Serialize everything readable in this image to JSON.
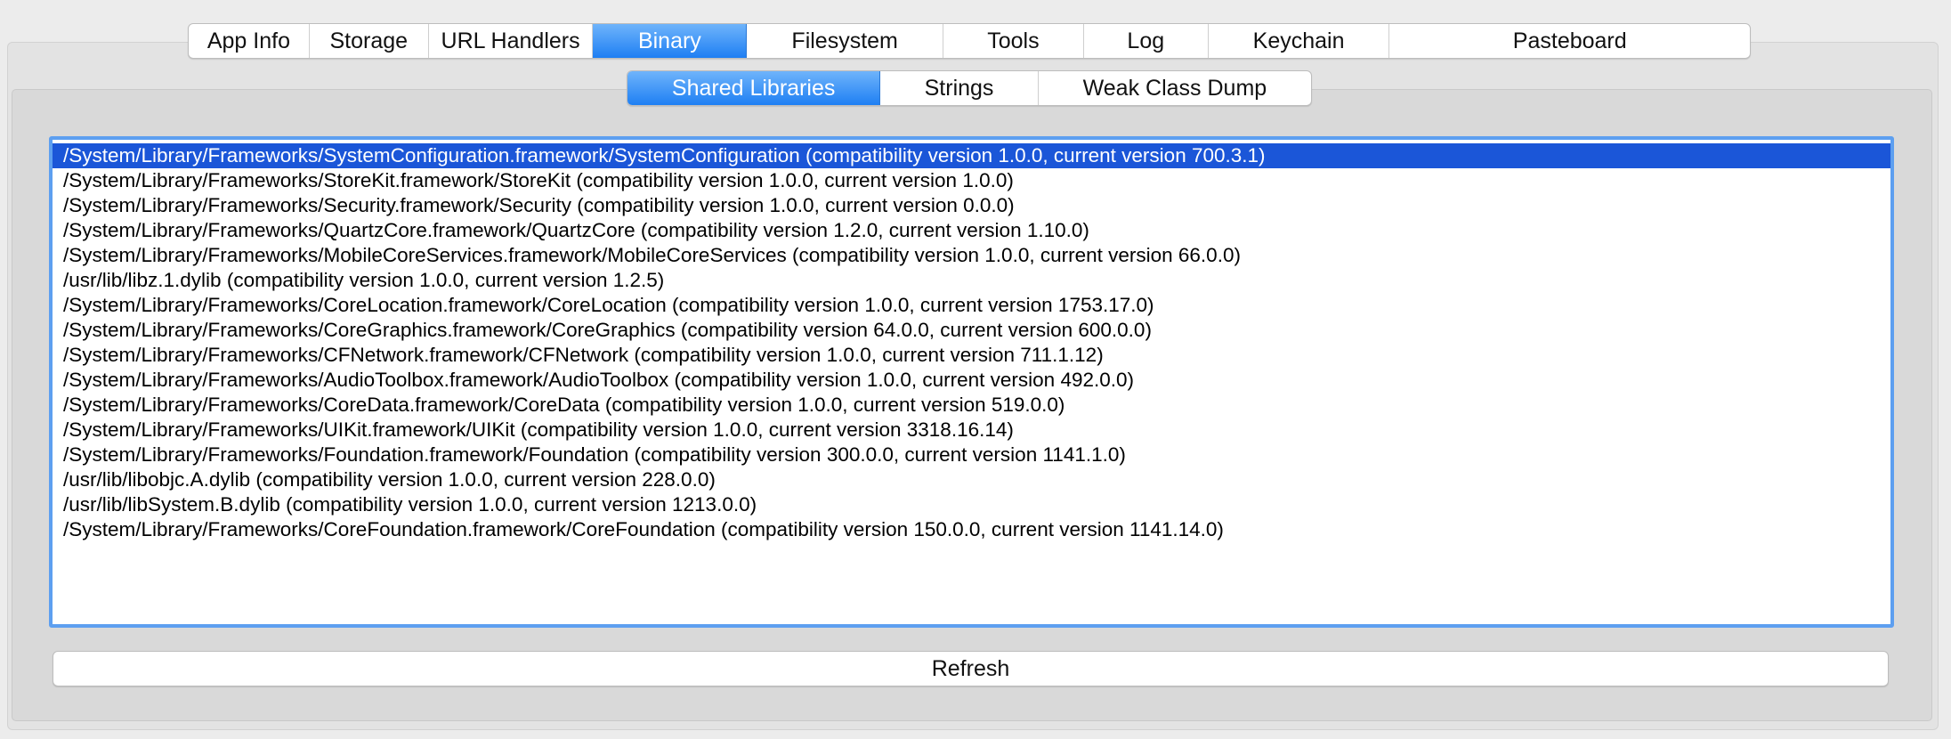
{
  "top_tabs": {
    "selected_index": 3,
    "items": [
      {
        "label": "App Info"
      },
      {
        "label": "Storage"
      },
      {
        "label": "URL Handlers"
      },
      {
        "label": "Binary"
      },
      {
        "label": "Filesystem"
      },
      {
        "label": "Tools"
      },
      {
        "label": "Log"
      },
      {
        "label": "Keychain"
      },
      {
        "label": "Pasteboard"
      }
    ]
  },
  "sub_tabs": {
    "selected_index": 0,
    "items": [
      {
        "label": "Shared Libraries"
      },
      {
        "label": "Strings"
      },
      {
        "label": "Weak Class Dump"
      }
    ]
  },
  "libraries": {
    "selected_index": 0,
    "rows": [
      "/System/Library/Frameworks/SystemConfiguration.framework/SystemConfiguration (compatibility version 1.0.0, current version 700.3.1)",
      "/System/Library/Frameworks/StoreKit.framework/StoreKit (compatibility version 1.0.0, current version 1.0.0)",
      "/System/Library/Frameworks/Security.framework/Security (compatibility version 1.0.0, current version 0.0.0)",
      "/System/Library/Frameworks/QuartzCore.framework/QuartzCore (compatibility version 1.2.0, current version 1.10.0)",
      "/System/Library/Frameworks/MobileCoreServices.framework/MobileCoreServices (compatibility version 1.0.0, current version 66.0.0)",
      "/usr/lib/libz.1.dylib (compatibility version 1.0.0, current version 1.2.5)",
      "/System/Library/Frameworks/CoreLocation.framework/CoreLocation (compatibility version 1.0.0, current version 1753.17.0)",
      "/System/Library/Frameworks/CoreGraphics.framework/CoreGraphics (compatibility version 64.0.0, current version 600.0.0)",
      "/System/Library/Frameworks/CFNetwork.framework/CFNetwork (compatibility version 1.0.0, current version 711.1.12)",
      "/System/Library/Frameworks/AudioToolbox.framework/AudioToolbox (compatibility version 1.0.0, current version 492.0.0)",
      "/System/Library/Frameworks/CoreData.framework/CoreData (compatibility version 1.0.0, current version 519.0.0)",
      "/System/Library/Frameworks/UIKit.framework/UIKit (compatibility version 1.0.0, current version 3318.16.14)",
      "/System/Library/Frameworks/Foundation.framework/Foundation (compatibility version 300.0.0, current version 1141.1.0)",
      "/usr/lib/libobjc.A.dylib (compatibility version 1.0.0, current version 228.0.0)",
      "/usr/lib/libSystem.B.dylib (compatibility version 1.0.0, current version 1213.0.0)",
      "/System/Library/Frameworks/CoreFoundation.framework/CoreFoundation (compatibility version 150.0.0, current version 1141.14.0)"
    ]
  },
  "refresh_button": {
    "label": "Refresh"
  },
  "colors": {
    "selection": "#1b56d8",
    "tab_selected": "#2f8cf6",
    "focus_ring": "#5d9ff0"
  }
}
